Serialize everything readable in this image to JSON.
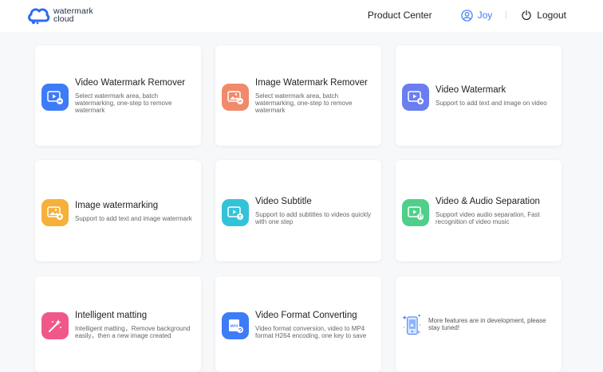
{
  "header": {
    "logo_line1": "watermark",
    "logo_line2": "cloud",
    "product_center": "Product Center",
    "username": "Joy",
    "logout": "Logout"
  },
  "cards": [
    {
      "title": "Video Watermark Remover",
      "desc": "Select watermark area, batch watermarking, one-step to remove watermark",
      "icon": "video-remove-icon",
      "color": "#3d7bf7"
    },
    {
      "title": "Image Watermark Remover",
      "desc": "Select watermark area, batch watermarking, one-step to remove watermark",
      "icon": "image-remove-icon",
      "color": "#f08a6a"
    },
    {
      "title": "Video Watermark",
      "desc": "Support to add text and image on video",
      "icon": "video-watermark-icon",
      "color": "#6a7ef0"
    },
    {
      "title": "Image watermarking",
      "desc": "Support to add text and image watermark",
      "icon": "image-watermark-icon",
      "color": "#f5b13a"
    },
    {
      "title": "Video Subtitle",
      "desc": "Support to add subtitles to videos quickly with one step",
      "icon": "video-subtitle-icon",
      "color": "#33c3d9"
    },
    {
      "title": "Video & Audio Separation",
      "desc": "Support video audio separation, Fast recognition of video music",
      "icon": "audio-separation-icon",
      "color": "#4fcf8a"
    },
    {
      "title": "Intelligent matting",
      "desc": "Intelligent matting，Remove background easily，then a new image created",
      "icon": "matting-icon",
      "color": "#f0588a"
    },
    {
      "title": "Video Format Converting",
      "desc": "Video format conversion, video to MP4 format H264 encoding, one key to save",
      "icon": "format-convert-icon",
      "color": "#3d7bf7",
      "badge": "MP4"
    },
    {
      "more": "More features are in development, please stay tuned!",
      "icon": "coming-soon-icon"
    }
  ]
}
